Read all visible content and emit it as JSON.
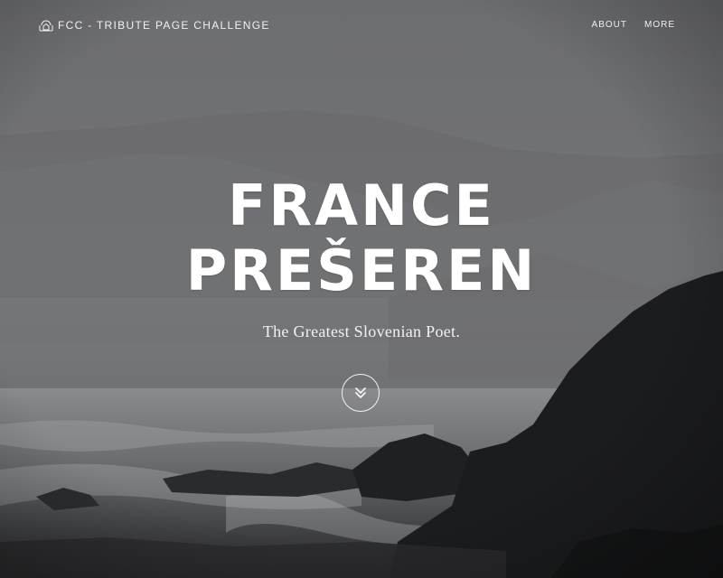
{
  "nav": {
    "brand_icon": "home-icon",
    "brand": "FCC - TRIBUTE PAGE CHALLENGE",
    "links": [
      {
        "label": "ABOUT"
      },
      {
        "label": "MORE"
      }
    ]
  },
  "hero": {
    "title_line_1": "FRANCE",
    "title_line_2": "PREŠEREN",
    "subtitle": "The Greatest Slovenian Poet.",
    "scroll_icon": "chevrons-down-icon",
    "background": "misty coastal seascape with dark rocky cliffs"
  }
}
